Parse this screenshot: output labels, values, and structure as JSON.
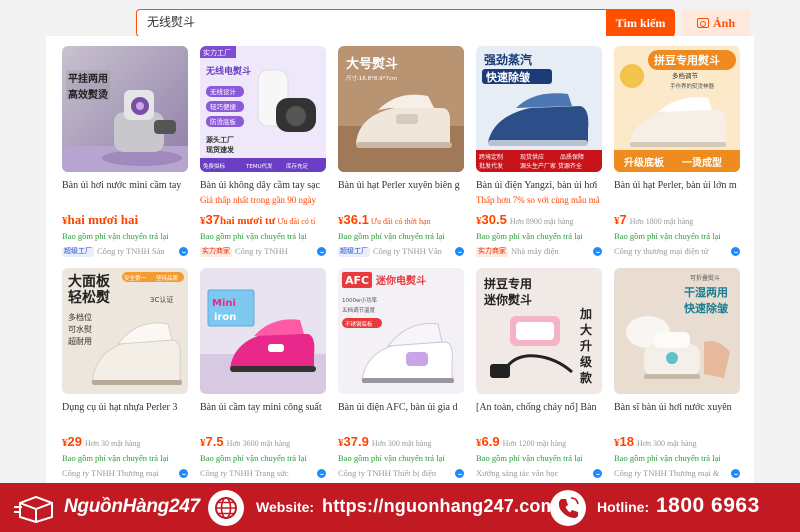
{
  "search": {
    "query": "无线熨斗",
    "button_label": "Tìm kiếm",
    "image_button_label": "Ảnh"
  },
  "products": [
    {
      "image_text": [
        "平挂两用",
        "高效熨烫"
      ],
      "name": "Bàn ủi hơi nước mini cầm tay",
      "promo": "",
      "currency": "¥",
      "price": "hai mươi hai",
      "sold": "",
      "inline_promo": "",
      "shipping": "Bao gồm phí vận chuyển trả lại",
      "badge": "超级工厂",
      "badge_color": "blue",
      "shop": "Công ty TNHH Sản"
    },
    {
      "image_text": [
        "实力工厂",
        "无线电熨斗",
        "无线设计",
        "轻巧便捷",
        "防烫底板",
        "源头工厂",
        "现货速发",
        "免费拟标",
        "TEMU代发",
        "库存充足"
      ],
      "name": "Bàn ủi không dây cầm tay sạc",
      "promo": "Giá thấp nhất trong gần 90 ngày",
      "currency": "¥",
      "price": "37",
      "price_suffix": "hai mươi tư",
      "sold": "",
      "inline_promo": "Ưu đãi có tí",
      "shipping": "Bao gồm phí vận chuyển trả lại",
      "badge": "实力商家",
      "badge_color": "red",
      "shop": "Công ty TNHH"
    },
    {
      "image_text": [
        "大号熨斗",
        "尺寸:16.8*8.9*7cm"
      ],
      "name": "Bàn ủi hạt Perler xuyên biên g",
      "promo": "",
      "currency": "¥",
      "price": "36.1",
      "sold": "",
      "inline_promo": "Ưu đãi có thời hạn",
      "shipping": "Bao gồm phí vận chuyển trả lại",
      "badge": "超级工厂",
      "badge_color": "blue",
      "shop": "Công ty TNHH Văn"
    },
    {
      "image_text": [
        "强劲蒸汽",
        "快速除皱",
        "跨境定制",
        "批发代发",
        "现货供应",
        "品质保障",
        "源头生产厂家 货源齐全"
      ],
      "name": "Bàn ủi điện Yangzi, bàn ủi hơi",
      "promo": "Thấp hơn 7% so với cùng mẫu mã",
      "currency": "¥",
      "price": "30.5",
      "sold": "Hơn 8900 mặt hàng",
      "inline_promo": "",
      "shipping": "Bao gồm phí vận chuyển trả lại",
      "badge": "实力商家",
      "badge_color": "red",
      "shop": "Nhà máy điện"
    },
    {
      "image_text": [
        "拼豆专用熨斗",
        "多档调节",
        "手作界的熨烫神器",
        "升级底板",
        "一烫成型"
      ],
      "name": "Bàn ủi hạt Perler, bàn ủi lớn m",
      "promo": "",
      "currency": "¥",
      "price": "7",
      "sold": "Hơn 1800 mặt hàng",
      "inline_promo": "",
      "shipping": "Bao gồm phí vận chuyển trả lại",
      "badge": "",
      "badge_color": "",
      "shop": "Công ty thương mại điện tử"
    },
    {
      "image_text": [
        "大面板",
        "轻松熨",
        "多档位",
        "可水熨",
        "超耐用",
        "3C认证",
        "安全第一",
        "坚持品质"
      ],
      "name": "Dụng cụ ủi hạt nhựa Perler 3",
      "promo": "",
      "currency": "¥",
      "price": "29",
      "sold": "Hơn 30 mặt hàng",
      "inline_promo": "",
      "shipping": "Bao gồm phí vận chuyển trả lại",
      "badge": "",
      "badge_color": "",
      "shop": "Công ty TNHH Thương mại"
    },
    {
      "image_text": [
        "Mini",
        "iron"
      ],
      "name": "Bàn ủi cầm tay mini công suất",
      "promo": "",
      "currency": "¥",
      "price": "7.5",
      "sold": "Hơn 3600 mặt hàng",
      "inline_promo": "",
      "shipping": "Bao gồm phí vận chuyển trả lại",
      "badge": "",
      "badge_color": "",
      "shop": "Công ty TNHH Trang sức"
    },
    {
      "image_text": [
        "AFC",
        "迷你电熨斗",
        "1000w小功率",
        "五档调节温度",
        "不锈钢底板"
      ],
      "name": "Bàn ủi điện AFC, bàn ủi gia d",
      "promo": "",
      "currency": "¥",
      "price": "37.9",
      "sold": "Hơn 300 mặt hàng",
      "inline_promo": "",
      "shipping": "Bao gồm phí vận chuyển trả lại",
      "badge": "",
      "badge_color": "",
      "shop": "Công ty TNHH Thiết bị điện"
    },
    {
      "image_text": [
        "拼豆专用",
        "迷你熨斗",
        "加",
        "大",
        "升",
        "级",
        "款"
      ],
      "name": "[An toàn, chống cháy nổ] Bàn",
      "promo": "",
      "currency": "¥",
      "price": "6.9",
      "sold": "Hơn 1200 mặt hàng",
      "inline_promo": "",
      "shipping": "Bao gồm phí vận chuyển trả lại",
      "badge": "",
      "badge_color": "",
      "shop": "Xưởng sáng tác văn học"
    },
    {
      "image_text": [
        "可折叠熨斗",
        "干湿两用",
        "快速除皱"
      ],
      "name": "Bàn sĩ bàn ủi hơi nước xuyên",
      "promo": "",
      "currency": "¥",
      "price": "18",
      "sold": "Hơn 300 mặt hàng",
      "inline_promo": "",
      "shipping": "Bao gồm phí vận chuyển trả lại",
      "badge": "",
      "badge_color": "",
      "shop": "Công ty TNHH Thương mại &"
    }
  ],
  "footer": {
    "brand": "NguồnHàng247",
    "website_label": "Website:",
    "website_url": "https://nguonhang247.com/",
    "hotline_label": "Hotline:",
    "hotline_number": "1800 6963"
  },
  "colors": {
    "accent": "#ff5000",
    "price": "#ff4400",
    "shipping": "#2a9d3a",
    "footer_bg": "#c21a23"
  }
}
